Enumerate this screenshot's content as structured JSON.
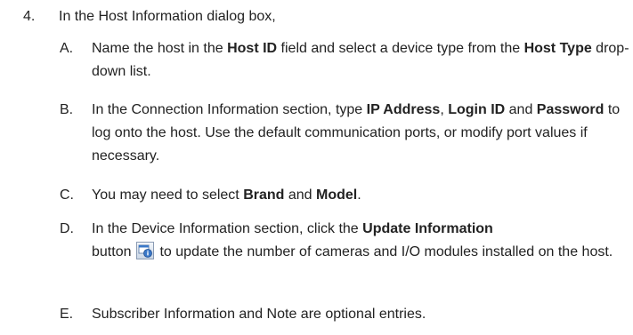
{
  "step": {
    "number": "4.",
    "text": "In the Host Information dialog box,"
  },
  "substeps": {
    "a": {
      "letter": "A.",
      "t1": "Name the host in the ",
      "b1": "Host ID",
      "t2": " field and select a device type from the ",
      "b2": "Host Type",
      "t3": " drop-down list."
    },
    "b": {
      "letter": "B.",
      "t1": "In the Connection Information section, type ",
      "b1": "IP Address",
      "t2": ", ",
      "b2": "Login ID",
      "t3": " and ",
      "b3": "Password",
      "t4": " to log onto the host. Use the default communication ports, or modify port values if necessary."
    },
    "c": {
      "letter": "C.",
      "t1": "You may need to select ",
      "b1": "Brand",
      "t2": " and ",
      "b2": "Model",
      "t3": "."
    },
    "d": {
      "letter": "D.",
      "t1": "In the Device Information section, click the ",
      "b1": "Update Information",
      "t2": " button",
      "t3": "to update the number of cameras and I/O modules installed on the host.",
      "icon": "update-information-icon"
    },
    "e": {
      "letter": "E.",
      "t1": "Subscriber Information and Note are optional entries."
    }
  },
  "colors": {
    "text": "#222222",
    "icon_blue": "#3a78c8"
  }
}
